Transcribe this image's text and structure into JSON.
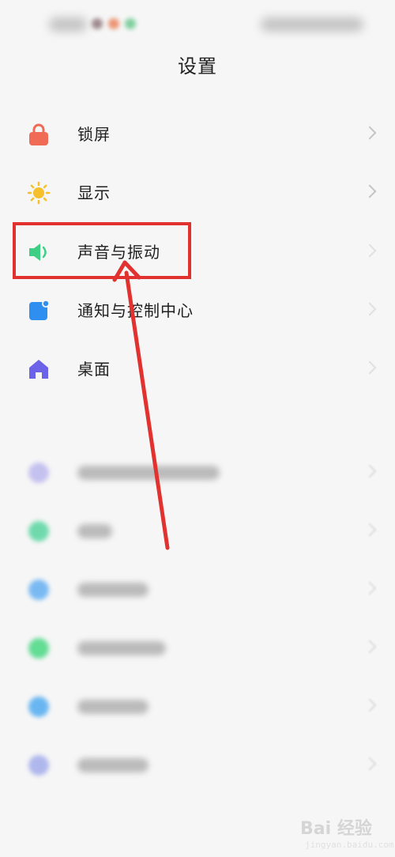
{
  "header": {
    "title": "设置"
  },
  "settings_group_1": [
    {
      "label": "锁屏",
      "icon": "lock-icon",
      "color": "#ef6b55"
    },
    {
      "label": "显示",
      "icon": "sun-icon",
      "color": "#f5c02c"
    },
    {
      "label": "声音与振动",
      "icon": "speaker-icon",
      "color": "#3ecf85"
    },
    {
      "label": "通知与控制中心",
      "icon": "notification-icon",
      "color": "#2f8ff0"
    },
    {
      "label": "桌面",
      "icon": "home-icon",
      "color": "#6c63e8"
    }
  ],
  "settings_group_2_blurred_colors": [
    "#b9b4ee",
    "#4fd39a",
    "#5aaaf2",
    "#3fd67c",
    "#46a6f0",
    "#9fa8ea"
  ],
  "annotation": {
    "highlight_color": "#e2322f",
    "highlighted_item": "声音与振动"
  },
  "watermark": {
    "text": "Bai 经验",
    "sub": "jingyan.baidu.com"
  }
}
